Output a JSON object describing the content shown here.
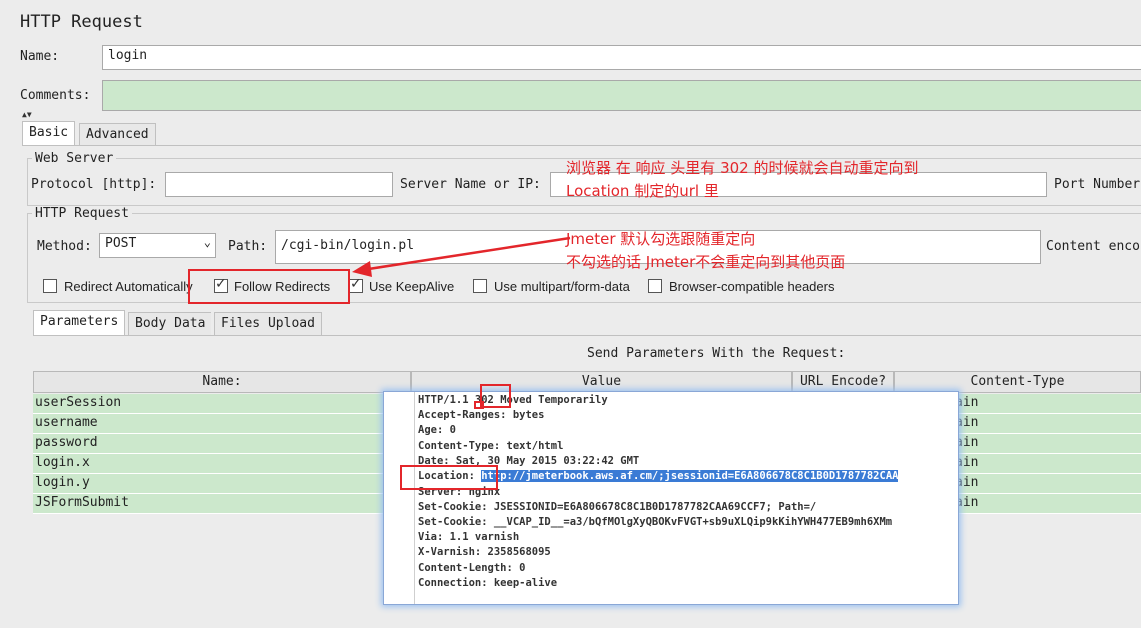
{
  "panel": {
    "title": "HTTP Request"
  },
  "name": {
    "label": "Name:",
    "value": "login"
  },
  "comments": {
    "label": "Comments:",
    "value": ""
  },
  "tabs": [
    {
      "label": "Basic"
    },
    {
      "label": "Advanced"
    }
  ],
  "web_server": {
    "legend": "Web Server",
    "protocol_label": "Protocol [http]:",
    "protocol_value": "",
    "server_label": "Server Name or IP:",
    "server_value": "",
    "port_label": "Port Number"
  },
  "http_request": {
    "legend": "HTTP Request",
    "method_label": "Method:",
    "method_value": "POST",
    "path_label": "Path:",
    "path_value": "/cgi-bin/login.pl",
    "content_label": "Content enco"
  },
  "options": [
    {
      "label": "Redirect Automatically",
      "checked": false
    },
    {
      "label": "Follow Redirects",
      "checked": true
    },
    {
      "label": "Use KeepAlive",
      "checked": true
    },
    {
      "label": "Use multipart/form-data",
      "checked": false
    },
    {
      "label": "Browser-compatible headers",
      "checked": false
    }
  ],
  "subtabs": [
    {
      "label": "Parameters"
    },
    {
      "label": "Body Data"
    },
    {
      "label": "Files Upload"
    }
  ],
  "params": {
    "title": "Send Parameters With the Request:",
    "headers": [
      "Name:",
      "Value",
      "URL Encode?",
      "Content-Type"
    ],
    "rows": [
      {
        "name": "userSession",
        "ct": "ain"
      },
      {
        "name": "username",
        "ct": "ain"
      },
      {
        "name": "password",
        "ct": "ain"
      },
      {
        "name": "login.x",
        "ct": "ain"
      },
      {
        "name": "login.y",
        "ct": "ain"
      },
      {
        "name": "JSFormSubmit",
        "ct": "ain"
      }
    ]
  },
  "annotations": {
    "note1_line1": "浏览器 在 响应 头里有 302 的时候就会自动重定向到",
    "note1_line2": "Location 制定的url 里",
    "note2_line1": "Jmeter 默认勾选跟随重定向",
    "note2_line2": "不勾选的话 Jmeter不会重定向到其他页面"
  },
  "response": {
    "status_pre": "HTTP/1.1 ",
    "status_code": "302",
    "status_post": " Moved Temporarily",
    "accept_ranges": "Accept-Ranges: bytes",
    "age": "Age: 0",
    "content_type": "Content-Type: text/html",
    "date": "Date: Sat, 30 May 2015 03:22:42 GMT",
    "location_label": "Location:",
    "location_value": "http://jmeterbook.aws.af.cm/;jsessionid=E6A806678C8C1B0D1787782CAA",
    "server": "Server: nginx",
    "set_cookie1": "Set-Cookie: JSESSIONID=E6A806678C8C1B0D1787782CAA69CCF7; Path=/",
    "set_cookie2": "Set-Cookie: __VCAP_ID__=a3/bQfMOlgXyQBOKvFVGT+sb9uXLQip9kKihYWH477EB9mh6XMm",
    "via": "Via: 1.1 varnish",
    "x_varnish": "X-Varnish: 2358568095",
    "content_length": "Content-Length: 0",
    "connection": "Connection: keep-alive"
  },
  "colors": {
    "annotation": "#e3262b",
    "field_green": "#cce8cc",
    "selection": "#3a7bd5"
  }
}
